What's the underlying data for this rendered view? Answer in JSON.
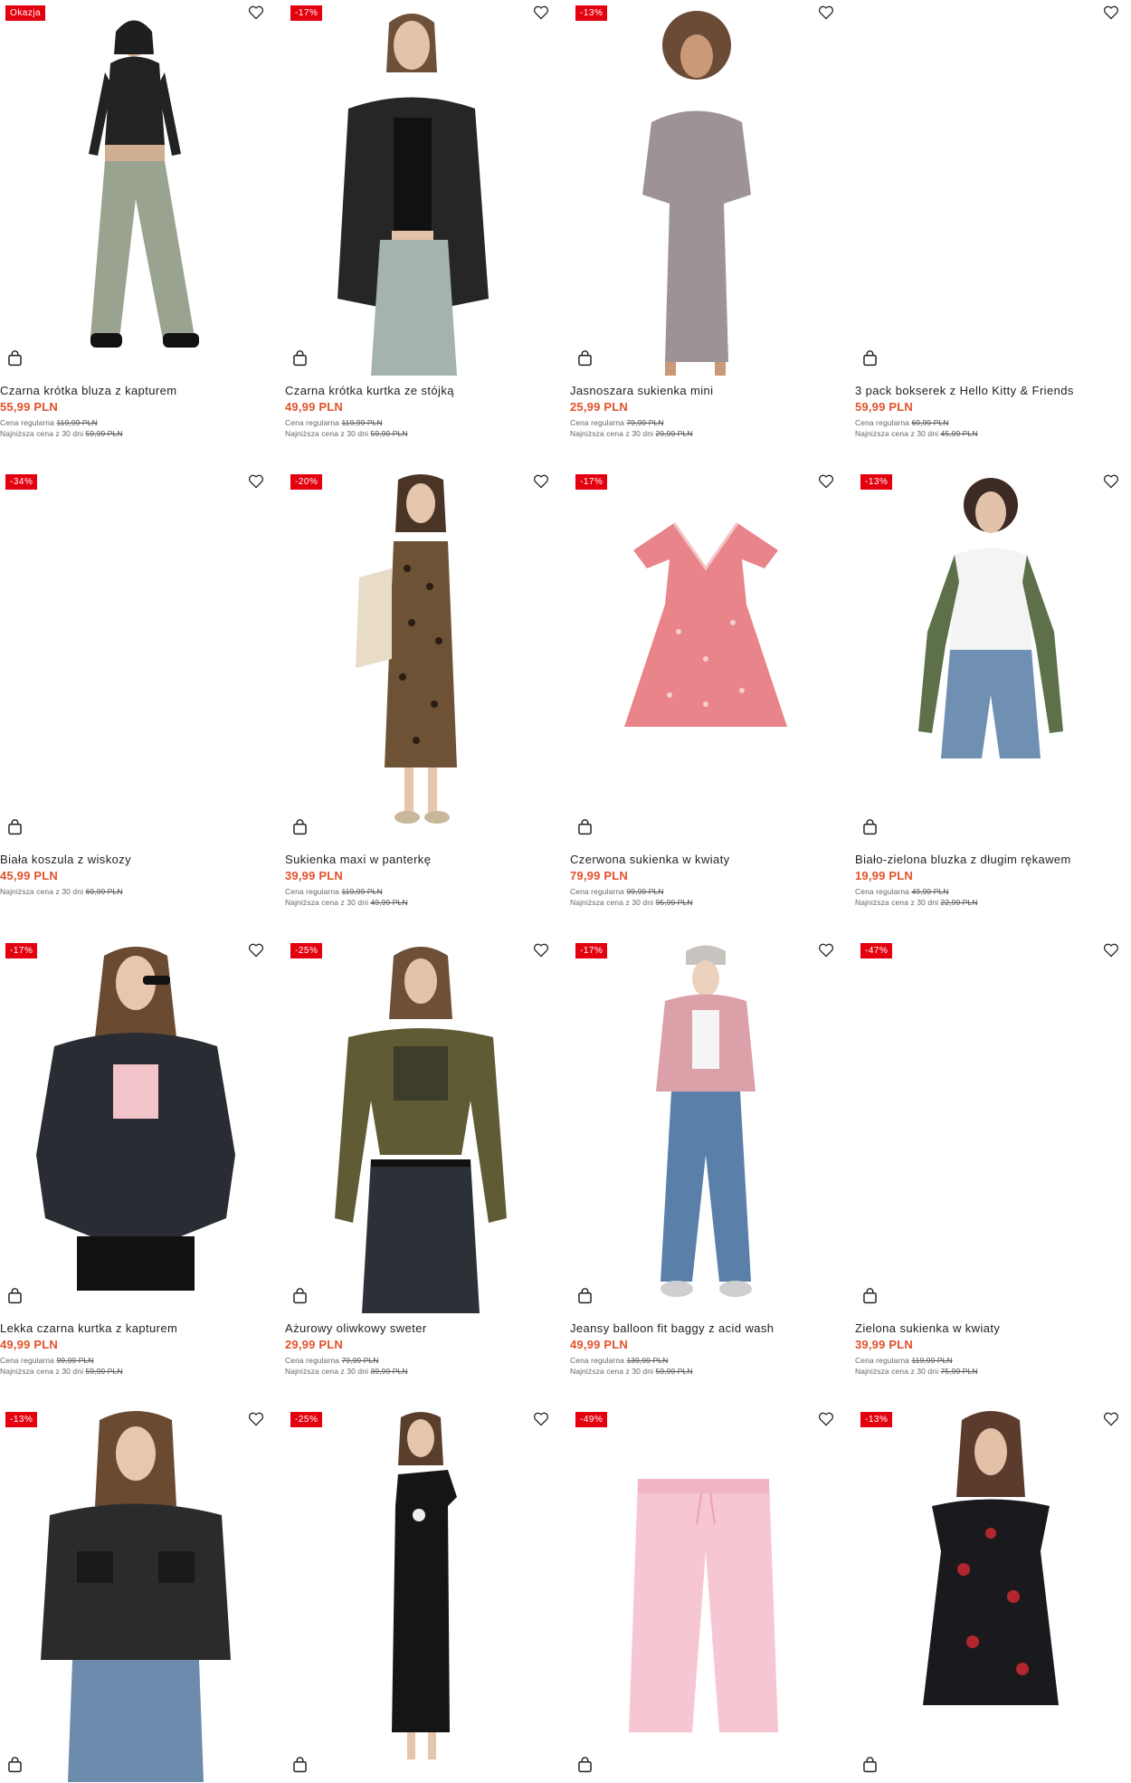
{
  "labels": {
    "regular": "Cena regularna",
    "lowest": "Najniższa cena z 30 dni",
    "currency": "PLN"
  },
  "colors": {
    "badge_bg": "#e3000f",
    "price": "#e2522a",
    "text": "#222222"
  },
  "products": [
    {
      "badge": "Okazja",
      "title": "Czarna krótka bluza z kapturem",
      "price": "55,99 PLN",
      "regular": "119,99 PLN",
      "lowest": "59,99 PLN",
      "image": "woman-black-cropped-hoodie-wide-jeans"
    },
    {
      "badge": "-17%",
      "title": "Czarna krótka kurtka ze stójką",
      "price": "49,99 PLN",
      "regular": "119,99 PLN",
      "lowest": "59,99 PLN",
      "image": "woman-black-leather-jacket"
    },
    {
      "badge": "-13%",
      "title": "Jasnoszara sukienka mini",
      "price": "25,99 PLN",
      "regular": "79,99 PLN",
      "lowest": "29,99 PLN",
      "image": "woman-grey-mini-dress"
    },
    {
      "badge": "",
      "title": "3 pack bokserek z Hello Kitty & Friends",
      "price": "59,99 PLN",
      "regular": "69,99 PLN",
      "lowest": "45,99 PLN",
      "image": "blank"
    },
    {
      "badge": "-34%",
      "title": "Biała koszula z wiskozy",
      "price": "45,99 PLN",
      "regular": "",
      "lowest": "69,99 PLN",
      "image": "blank"
    },
    {
      "badge": "-20%",
      "title": "Sukienka maxi w panterkę",
      "price": "39,99 PLN",
      "regular": "119,99 PLN",
      "lowest": "49,99 PLN",
      "image": "woman-leopard-maxi-dress"
    },
    {
      "badge": "-17%",
      "title": "Czerwona sukienka w kwiaty",
      "price": "79,99 PLN",
      "regular": "99,99 PLN",
      "lowest": "95,99 PLN",
      "image": "red-floral-dress-flat"
    },
    {
      "badge": "-13%",
      "title": "Biało-zielona bluzka z długim rękawem",
      "price": "19,99 PLN",
      "regular": "49,99 PLN",
      "lowest": "22,99 PLN",
      "image": "woman-raglan-top-jeans"
    },
    {
      "badge": "-17%",
      "title": "Lekka czarna kurtka z kapturem",
      "price": "49,99 PLN",
      "regular": "99,99 PLN",
      "lowest": "59,99 PLN",
      "image": "woman-black-windbreaker"
    },
    {
      "badge": "-25%",
      "title": "Ażurowy oliwkowy sweter",
      "price": "29,99 PLN",
      "regular": "79,99 PLN",
      "lowest": "39,99 PLN",
      "image": "woman-olive-mesh-sweater"
    },
    {
      "badge": "-17%",
      "title": "Jeansy balloon fit baggy z acid wash",
      "price": "49,99 PLN",
      "regular": "139,99 PLN",
      "lowest": "59,99 PLN",
      "image": "woman-pink-jacket-jeans"
    },
    {
      "badge": "-47%",
      "title": "Zielona sukienka w kwiaty",
      "price": "39,99 PLN",
      "regular": "119,99 PLN",
      "lowest": "75,99 PLN",
      "image": "blank"
    },
    {
      "badge": "-13%",
      "title": "",
      "price": "",
      "regular": "",
      "lowest": "",
      "image": "woman-black-utility-jacket"
    },
    {
      "badge": "-25%",
      "title": "",
      "price": "",
      "regular": "",
      "lowest": "",
      "image": "woman-black-maxi-dress"
    },
    {
      "badge": "-49%",
      "title": "",
      "price": "",
      "regular": "",
      "lowest": "",
      "image": "pink-sweatpants-flat"
    },
    {
      "badge": "-13%",
      "title": "",
      "price": "",
      "regular": "",
      "lowest": "",
      "image": "woman-rose-print-dress"
    }
  ]
}
